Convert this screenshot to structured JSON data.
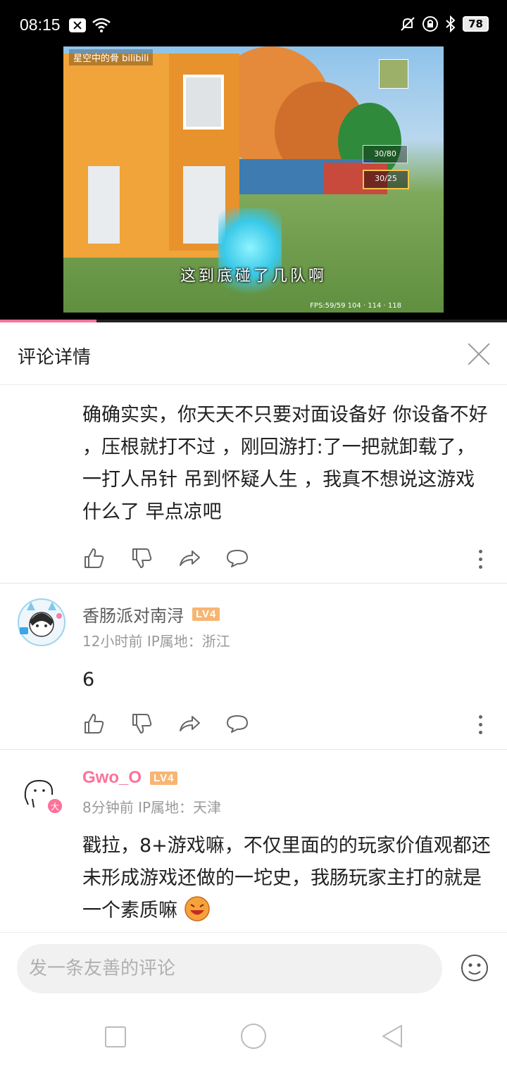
{
  "status_bar": {
    "time": "08:15",
    "battery": "78"
  },
  "video": {
    "subtitle": "这到底碰了几队啊",
    "overlay_channel": "星空中的骨 bilibili",
    "fps_text": "FPS:59/59  104 · 114 · 118",
    "hud_ammo_1": "30/80",
    "hud_ammo_2": "30/25",
    "progress": 0.19
  },
  "panel": {
    "title": "评论详情"
  },
  "comments": [
    {
      "text": "确确实实，你天天不只要对面设备好 你设备不好 ，压根就打不过 ，刚回游打:了一把就卸载了，一打人吊针 吊到怀疑人生 ，我真不想说这游戏什么了 早点凉吧"
    },
    {
      "username": "香肠派对南浔",
      "level": "LV4",
      "time": "12小时前",
      "ip": "IP属地：浙江",
      "text": "6"
    },
    {
      "username": "Gwo_O",
      "level": "LV4",
      "time": "8分钟前",
      "ip": "IP属地：天津",
      "badge": "大",
      "text": "戳拉，8+游戏嘛，不仅里面的的玩家价值观都还未形成游戏还做的一坨史，我肠玩家主打的就是一个素质嘛"
    }
  ],
  "input": {
    "placeholder": "发一条友善的评论"
  },
  "icons": {
    "like": "thumbs-up-icon",
    "dislike": "thumbs-down-icon",
    "share": "share-icon",
    "reply": "chat-bubble-icon",
    "more": "more-vertical-icon",
    "emoji": "emoji-icon"
  },
  "colors": {
    "accent": "#fb7299",
    "level_badge": "#f8b572"
  }
}
